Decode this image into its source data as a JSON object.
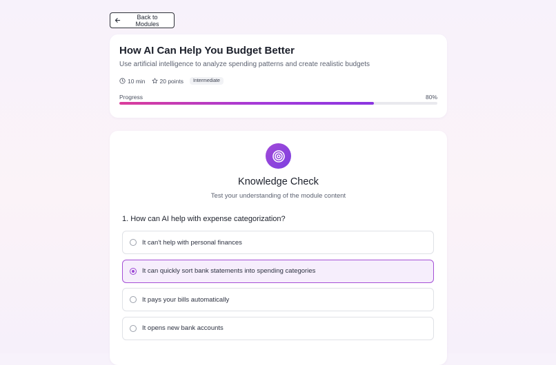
{
  "header": {
    "back_label": "Back to Modules"
  },
  "module": {
    "title": "How AI Can Help You Budget Better",
    "description": "Use artificial intelligence to analyze spending patterns and create realistic budgets",
    "duration": "10 min",
    "points": "20 points",
    "level": "Intermediate",
    "progress_label": "Progress",
    "progress_text": "80%",
    "progress_fraction": 0.8
  },
  "quiz": {
    "title": "Knowledge Check",
    "subtitle": "Test your understanding of the module content",
    "question": "1. How can AI help with expense categorization?",
    "options": [
      {
        "label": "It can't help with personal finances",
        "selected": false
      },
      {
        "label": "It can quickly sort bank statements into spending categories",
        "selected": true
      },
      {
        "label": "It pays your bills automatically",
        "selected": false
      },
      {
        "label": "It opens new bank accounts",
        "selected": false
      }
    ]
  },
  "icons": {
    "back": "arrow-left-icon",
    "duration": "clock-icon",
    "points": "star-icon",
    "quiz": "target-icon",
    "option_unselected": "radio-unchecked-icon",
    "option_selected": "radio-checked-icon"
  },
  "colors": {
    "accent": "#a44fd6",
    "accent_soft": "#f6eefc",
    "progress_start": "#db3d9b",
    "progress_end": "#8b36e0"
  }
}
